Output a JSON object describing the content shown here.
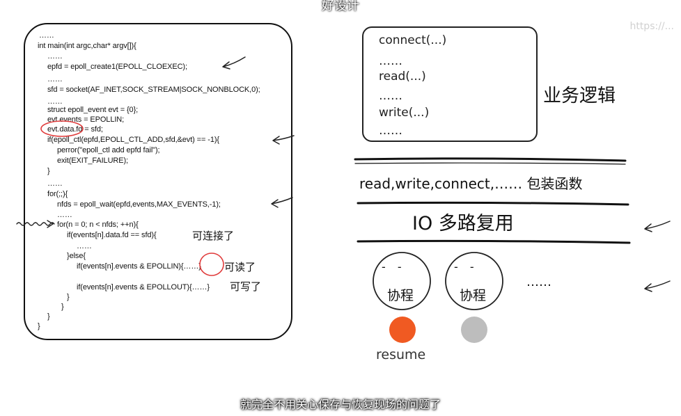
{
  "video_title": "好设计",
  "watermark": "https://...",
  "code": {
    "lines": [
      "……",
      "int main(int argc,char* argv[]){",
      "……",
      "epfd = epoll_create1(EPOLL_CLOEXEC);",
      "……",
      "sfd = socket(AF_INET,SOCK_STREAM|SOCK_NONBLOCK,0);",
      "……",
      "struct epoll_event evt = {0};",
      "evt.events = EPOLLIN;",
      "evt.data.fd = sfd;",
      "if(epoll_ctl(epfd,EPOLL_CTL_ADD,sfd,&evt) == -1){",
      "perror(\"epoll_ctl add epfd fail\");",
      "exit(EXIT_FAILURE);",
      "}",
      "……",
      "for(;;){",
      "nfds = epoll_wait(epfd,events,MAX_EVENTS,-1);",
      "……",
      "for(n = 0; n < nfds; ++n){",
      "if(events[n].data.fd == sfd){",
      "……",
      "}else{",
      "if(events[n].events & EPOLLIN){……}",
      "if(events[n].events & EPOLLOUT){……}",
      "}",
      "}",
      "}",
      "}"
    ],
    "notes": {
      "connectable": "可连接了",
      "readable": "可读了",
      "writable": "可写了"
    }
  },
  "business": {
    "lines": [
      "connect(...)",
      "……",
      "read(...)",
      "……",
      "write(...)",
      "……"
    ],
    "label": "业务逻辑"
  },
  "wrapper_label": "read,write,connect,…… 包装函数",
  "io_label": "IO 多路复用",
  "coroutines": {
    "items": [
      {
        "label": "协程",
        "eyes": "- -"
      },
      {
        "label": "协程",
        "eyes": "- -"
      }
    ],
    "more": "……",
    "dot_colors": [
      "#f05a22",
      "#bdbdbd"
    ],
    "resume_label": "resume"
  },
  "subtitle": "就完全不用关心保存与恢复现场的问题了"
}
